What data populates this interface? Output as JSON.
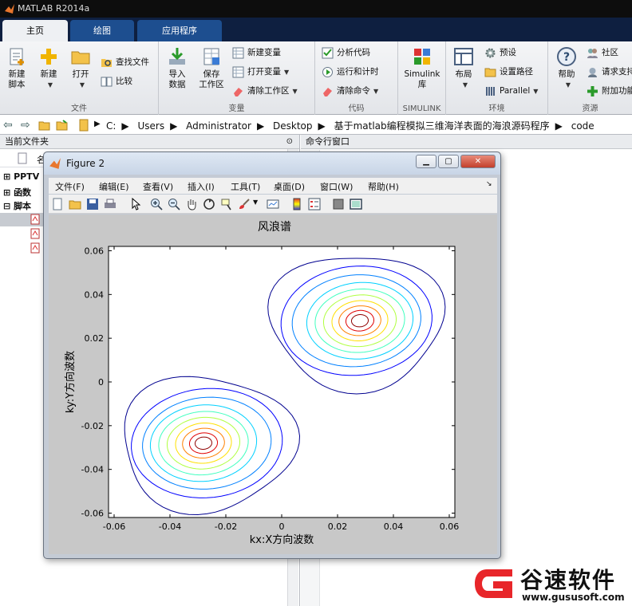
{
  "app": {
    "title": "MATLAB R2014a"
  },
  "tabs": [
    {
      "label": "主页",
      "active": true
    },
    {
      "label": "绘图",
      "active": false
    },
    {
      "label": "应用程序",
      "active": false
    }
  ],
  "ribbon": {
    "file": {
      "label": "文件",
      "new_script": "新建\n脚本",
      "new": "新建",
      "open": "打开",
      "find_files": "查找文件",
      "compare": "比较"
    },
    "variable": {
      "label": "变量",
      "import": "导入\n数据",
      "save_workspace": "保存\n工作区",
      "new_variable": "新建变量",
      "open_variable": "打开变量",
      "clear_workspace": "清除工作区"
    },
    "code": {
      "label": "代码",
      "analyze": "分析代码",
      "run_time": "运行和计时",
      "clear_commands": "清除命令"
    },
    "simulink": {
      "label": "SIMULINK",
      "library": "Simulink\n库"
    },
    "environment": {
      "label": "环境",
      "layout": "布局",
      "preferences": "预设",
      "set_path": "设置路径",
      "parallel": "Parallel"
    },
    "resources": {
      "label": "资源",
      "help": "帮助",
      "community": "社区",
      "request_support": "请求支持",
      "addons": "附加功能"
    }
  },
  "address": {
    "crumbs": [
      "C:",
      "Users",
      "Administrator",
      "Desktop",
      "基于matlab编程模拟三维海洋表面的海浪源码程序",
      "code"
    ]
  },
  "current_folder": {
    "title": "当前文件夹",
    "column_name": "名",
    "items": [
      {
        "label": "PPTV"
      },
      {
        "label": "函数"
      },
      {
        "label": "脚本"
      }
    ]
  },
  "command_window": {
    "title": "命令行窗口"
  },
  "figure": {
    "title": "Figure 2",
    "menu": [
      "文件(F)",
      "编辑(E)",
      "查看(V)",
      "插入(I)",
      "工具(T)",
      "桌面(D)",
      "窗口(W)",
      "帮助(H)"
    ]
  },
  "chart_data": {
    "type": "contour",
    "title": "风浪谱",
    "xlabel": "kx:X方向波数",
    "ylabel": "ky:Y方向波数",
    "xlim": [
      -0.062,
      0.062
    ],
    "ylim": [
      -0.062,
      0.062
    ],
    "xticks": [
      "-0.06",
      "-0.04",
      "-0.02",
      "0",
      "0.02",
      "0.04",
      "0.06"
    ],
    "yticks": [
      "-0.06",
      "-0.04",
      "-0.02",
      "0",
      "0.02",
      "0.04",
      "0.06"
    ],
    "peaks": [
      {
        "center": [
          0.028,
          0.028
        ]
      },
      {
        "center": [
          -0.028,
          -0.028
        ]
      }
    ],
    "levels": 10,
    "colormap": [
      "#00008f",
      "#0000ff",
      "#0080ff",
      "#00d0ff",
      "#40ffbf",
      "#b0ff40",
      "#ffe000",
      "#ff8000",
      "#e00000",
      "#8f0000"
    ],
    "grid": false,
    "legend": "none"
  },
  "watermark": {
    "brand": "谷速软件",
    "url": "www.gususoft.com"
  }
}
